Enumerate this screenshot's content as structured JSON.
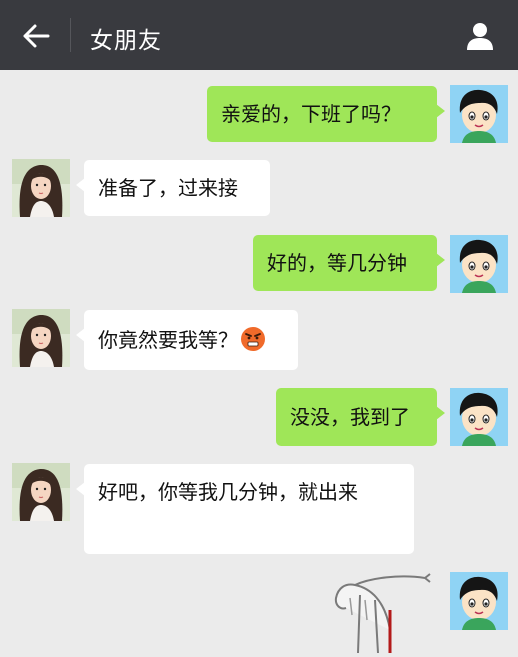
{
  "header": {
    "title": "女朋友",
    "back_icon": "arrow-left-icon",
    "profile_icon": "person-icon"
  },
  "colors": {
    "header_bg": "#393a3f",
    "chat_bg": "#ebebeb",
    "my_bubble": "#9fe658",
    "her_bubble": "#ffffff"
  },
  "messages": [
    {
      "sender": "me",
      "text": "亲爱的，下班了吗？"
    },
    {
      "sender": "her",
      "text": "准备了，过来接"
    },
    {
      "sender": "me",
      "text": "好的，等几分钟"
    },
    {
      "sender": "her",
      "text": "你竟然要我等？",
      "emoji": "angry-face-icon"
    },
    {
      "sender": "me",
      "text": "没没，我到了"
    },
    {
      "sender": "her",
      "text": "好吧，你等我几分钟，就出来"
    },
    {
      "sender": "me",
      "sticker": "bleeding-stick-figure-sticker"
    }
  ]
}
